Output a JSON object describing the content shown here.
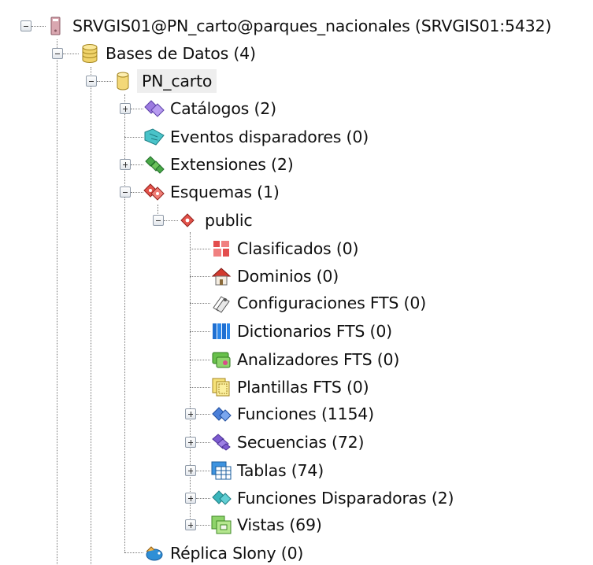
{
  "tree": {
    "server": {
      "label": "SRVGIS01@PN_carto@parques_nacionales (SRVGIS01:5432)",
      "icon": "server-icon"
    },
    "databases": {
      "label": "Bases de Datos (4)",
      "icon": "databases-icon"
    },
    "db": {
      "label": "PN_carto",
      "icon": "database-icon"
    },
    "catalogs": {
      "label": "Catálogos (2)",
      "icon": "catalogs-icon"
    },
    "event_triggers": {
      "label": "Eventos disparadores (0)",
      "icon": "event-triggers-icon"
    },
    "extensions": {
      "label": "Extensiones (2)",
      "icon": "extensions-icon"
    },
    "schemas": {
      "label": "Esquemas (1)",
      "icon": "schemas-icon"
    },
    "public": {
      "label": "public",
      "icon": "schema-icon"
    },
    "collations": {
      "label": "Clasificados (0)",
      "icon": "collations-icon"
    },
    "domains": {
      "label": "Dominios (0)",
      "icon": "domains-icon"
    },
    "fts_configs": {
      "label": "Configuraciones FTS (0)",
      "icon": "fts-config-icon"
    },
    "fts_dicts": {
      "label": "Dictionarios FTS (0)",
      "icon": "fts-dictionary-icon"
    },
    "fts_parsers": {
      "label": "Analizadores FTS (0)",
      "icon": "fts-parser-icon"
    },
    "fts_templates": {
      "label": "Plantillas FTS (0)",
      "icon": "fts-template-icon"
    },
    "functions": {
      "label": "Funciones (1154)",
      "icon": "functions-icon"
    },
    "sequences": {
      "label": "Secuencias (72)",
      "icon": "sequences-icon"
    },
    "tables": {
      "label": "Tablas (74)",
      "icon": "tables-icon"
    },
    "trigger_functions": {
      "label": "Funciones Disparadoras (2)",
      "icon": "trigger-functions-icon"
    },
    "views": {
      "label": "Vistas (69)",
      "icon": "views-icon"
    },
    "slony": {
      "label": "Réplica Slony (0)",
      "icon": "slony-icon"
    }
  }
}
